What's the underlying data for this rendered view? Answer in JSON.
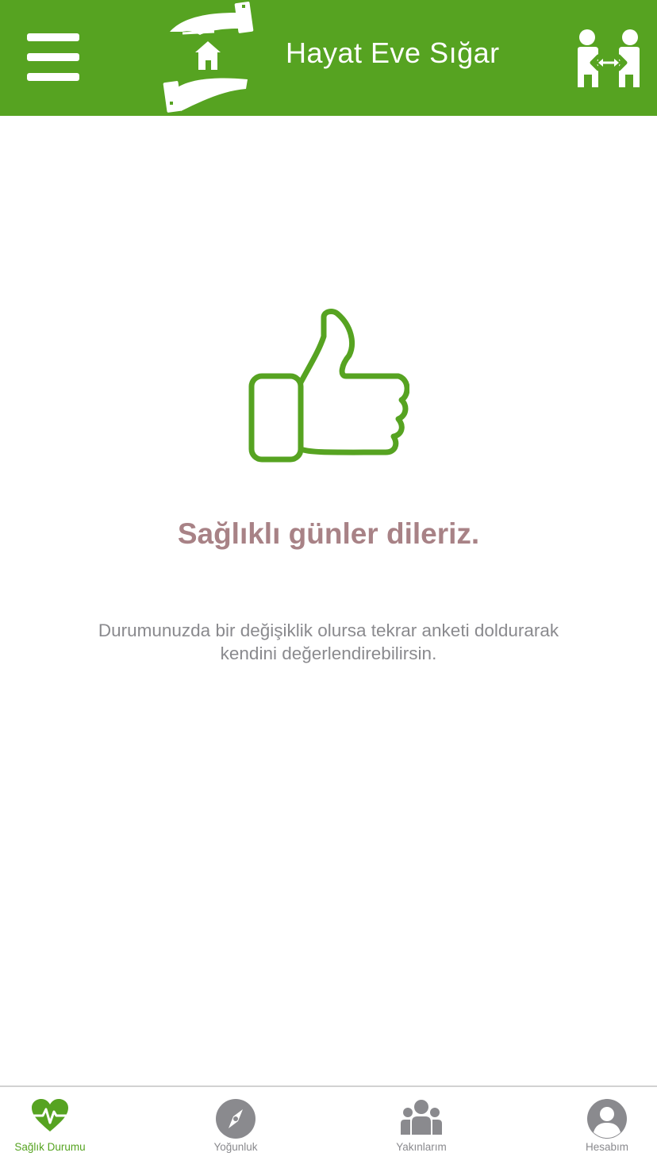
{
  "header": {
    "title": "Hayat Eve Sığar",
    "menu_icon": "hamburger-menu-icon",
    "logo_icon": "hands-house-logo",
    "right_icon": "social-distance-icon",
    "background_color": "#56a321"
  },
  "main": {
    "illustration_icon": "thumbs-up-icon",
    "headline": "Sağlıklı günler dileriz.",
    "message": "Durumunuzda bir değişiklik olursa tekrar anketi doldurarak kendini değerlendirebilirsin.",
    "headline_color": "#a88286",
    "message_color": "#8a8a8e",
    "accent_color": "#56a321"
  },
  "tabs": [
    {
      "label": "Sağlık Durumu",
      "icon": "heart-pulse-icon",
      "active": true
    },
    {
      "label": "Yoğunluk",
      "icon": "compass-icon",
      "active": false
    },
    {
      "label": "Yakınlarım",
      "icon": "group-icon",
      "active": false
    },
    {
      "label": "Hesabım",
      "icon": "user-icon",
      "active": false
    }
  ]
}
